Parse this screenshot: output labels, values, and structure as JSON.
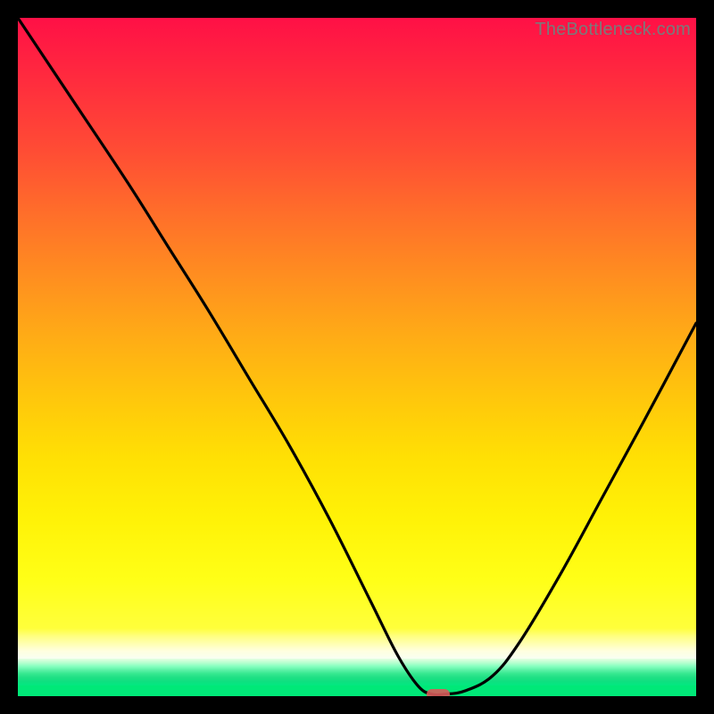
{
  "watermark": "TheBottleneck.com",
  "chart_data": {
    "type": "line",
    "title": "",
    "xlabel": "",
    "ylabel": "",
    "xlim": [
      0,
      100
    ],
    "ylim": [
      0,
      100
    ],
    "grid": false,
    "legend": false,
    "x": [
      0,
      8,
      16,
      22,
      28,
      34,
      40,
      46,
      52,
      56,
      59,
      61,
      63,
      66,
      70,
      74,
      80,
      86,
      92,
      100
    ],
    "values": [
      100,
      88,
      76,
      66.5,
      57,
      47,
      37,
      26,
      14,
      6,
      1.5,
      0.3,
      0.3,
      0.8,
      3,
      8,
      18,
      29,
      40,
      55
    ],
    "minimum_marker": {
      "x": 62,
      "y": 0.3
    },
    "gradient_bands": [
      {
        "from_y": 100,
        "to_y": 10,
        "desc": "red-to-yellow"
      },
      {
        "from_y": 10,
        "to_y": 5.5,
        "desc": "yellow-pale"
      },
      {
        "from_y": 5.5,
        "to_y": 1.6,
        "desc": "light-green-stripes"
      },
      {
        "from_y": 1.6,
        "to_y": 0,
        "desc": "solid-green"
      }
    ]
  }
}
